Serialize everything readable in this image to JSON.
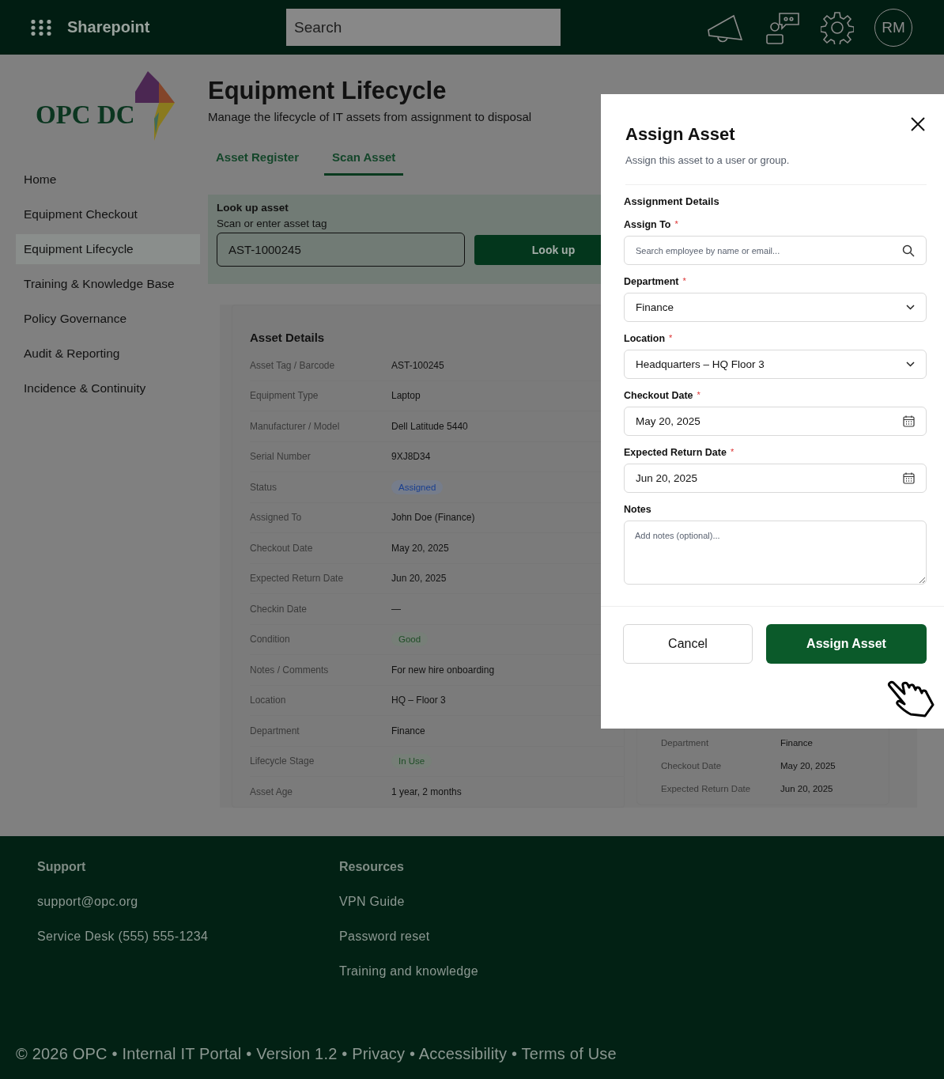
{
  "header": {
    "app_name": "Sharepoint",
    "search": {
      "placeholder": "Search"
    },
    "avatar": "RM"
  },
  "logo": {
    "text": "OPC DC"
  },
  "sidebar": {
    "items": [
      {
        "label": "Home",
        "selected": false
      },
      {
        "label": "Equipment Checkout",
        "selected": false
      },
      {
        "label": "Equipment Lifecycle",
        "selected": true
      },
      {
        "label": "Training & Knowledge Base",
        "selected": false
      },
      {
        "label": "Policy Governance",
        "selected": false
      },
      {
        "label": "Audit & Reporting",
        "selected": false
      },
      {
        "label": "Incidence & Continuity",
        "selected": false
      }
    ]
  },
  "page": {
    "title": "Equipment Lifecycle",
    "subtitle": "Manage the lifecycle of IT assets from assignment to disposal",
    "tabs": [
      {
        "label": "Asset Register",
        "selected": false
      },
      {
        "label": "Scan Asset",
        "selected": true
      }
    ],
    "lookup": {
      "title": "Look up asset",
      "hint": "Scan or enter asset tag",
      "value": "AST-1000245",
      "button": "Look up"
    },
    "details": {
      "title": "Asset Details",
      "rows": [
        {
          "label": "Asset Tag / Barcode",
          "value": "AST-100245",
          "kind": "text"
        },
        {
          "label": "Equipment Type",
          "value": "Laptop",
          "kind": "text"
        },
        {
          "label": "Manufacturer / Model",
          "value": "Dell Latitude 5440",
          "kind": "text"
        },
        {
          "label": "Serial Number",
          "value": "9XJ8D34",
          "kind": "text"
        },
        {
          "label": "Status",
          "value": "Assigned",
          "kind": "badge",
          "color": "#1a3f8f"
        },
        {
          "label": "Assigned To",
          "value": "John Doe  (Finance)",
          "kind": "text"
        },
        {
          "label": "Checkout Date",
          "value": "May 20, 2025",
          "kind": "text"
        },
        {
          "label": "Expected Return Date",
          "value": "Jun 20, 2025",
          "kind": "text"
        },
        {
          "label": "Checkin Date",
          "value": "—",
          "kind": "text"
        },
        {
          "label": "Condition",
          "value": "Good",
          "kind": "badge",
          "color": "#1e4d26"
        },
        {
          "label": "Notes / Comments",
          "value": "For new hire onboarding",
          "kind": "text"
        },
        {
          "label": "Location",
          "value": "HQ – Floor 3",
          "kind": "text"
        },
        {
          "label": "Department",
          "value": "Finance",
          "kind": "text"
        },
        {
          "label": "Lifecycle Stage",
          "value": "In Use",
          "kind": "badge",
          "color": "#1e4d26"
        },
        {
          "label": "Asset Age",
          "value": "1 year, 2 months",
          "kind": "text"
        }
      ]
    },
    "summary": {
      "rows": [
        {
          "label": "Department",
          "value": "Finance"
        },
        {
          "label": "Checkout Date",
          "value": "May 20, 2025"
        },
        {
          "label": "Expected Return Date",
          "value": "Jun 20, 2025"
        }
      ]
    }
  },
  "modal": {
    "title": "Assign Asset",
    "subtitle": "Assign this asset to a user or group.",
    "section": "Assignment Details",
    "fields": [
      {
        "label": "Assign To",
        "required": true,
        "kind": "search",
        "placeholder": "Search employee by name or email..."
      },
      {
        "label": "Department",
        "required": true,
        "kind": "select",
        "value": "Finance"
      },
      {
        "label": "Location",
        "required": true,
        "kind": "select",
        "value": "Headquarters – HQ Floor 3"
      },
      {
        "label": "Checkout Date",
        "required": true,
        "kind": "date",
        "value": "May 20, 2025"
      },
      {
        "label": "Expected Return Date",
        "required": true,
        "kind": "date",
        "value": "Jun 20, 2025"
      },
      {
        "label": "Notes",
        "kind": "textarea",
        "placeholder": "Add notes (optional)..."
      }
    ],
    "required_mark": "*",
    "cancel": "Cancel",
    "submit": "Assign Asset"
  },
  "footer": {
    "columns": [
      {
        "heading": "Support",
        "links": [
          "support@opc.org",
          "Service Desk (555) 555-1234"
        ]
      },
      {
        "heading": "Resources",
        "links": [
          "VPN Guide",
          "Password reset",
          "Training and knowledge"
        ]
      }
    ],
    "copyright": "© 2026 OPC • Internal IT Portal • Version 1.2 • Privacy • Accessibility • Terms of Use"
  }
}
